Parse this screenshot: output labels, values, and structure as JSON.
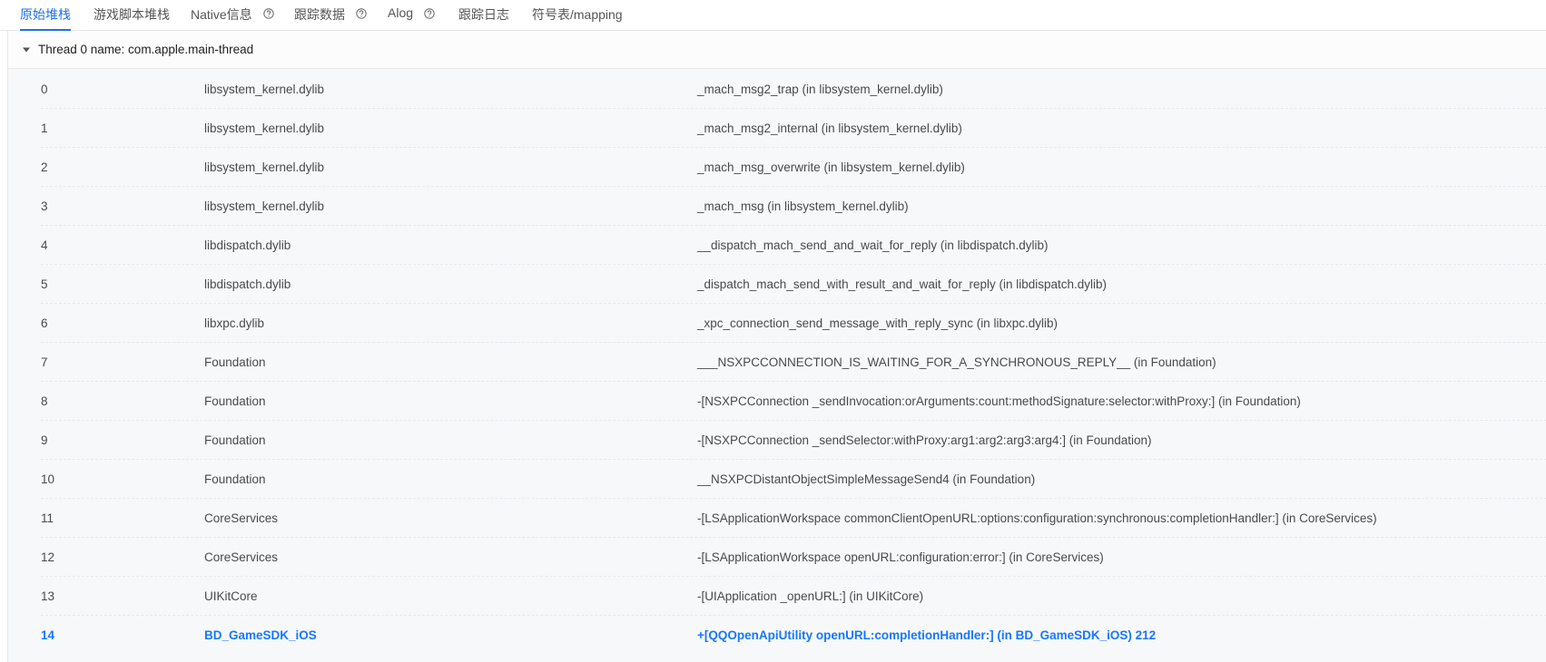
{
  "tabs": [
    {
      "label": "原始堆栈",
      "active": true,
      "has_help": false
    },
    {
      "label": "游戏脚本堆栈",
      "active": false,
      "has_help": false
    },
    {
      "label": "Native信息",
      "active": false,
      "has_help": true
    },
    {
      "label": "跟踪数据",
      "active": false,
      "has_help": true
    },
    {
      "label": "Alog",
      "active": false,
      "has_help": true
    },
    {
      "label": "跟踪日志",
      "active": false,
      "has_help": false
    },
    {
      "label": "符号表/mapping",
      "active": false,
      "has_help": false
    }
  ],
  "thread": {
    "title": "Thread 0 name: com.apple.main-thread",
    "expanded": true
  },
  "frames": [
    {
      "index": "0",
      "library": "libsystem_kernel.dylib",
      "symbol": "_mach_msg2_trap (in libsystem_kernel.dylib)"
    },
    {
      "index": "1",
      "library": "libsystem_kernel.dylib",
      "symbol": "_mach_msg2_internal (in libsystem_kernel.dylib)"
    },
    {
      "index": "2",
      "library": "libsystem_kernel.dylib",
      "symbol": "_mach_msg_overwrite (in libsystem_kernel.dylib)"
    },
    {
      "index": "3",
      "library": "libsystem_kernel.dylib",
      "symbol": "_mach_msg (in libsystem_kernel.dylib)"
    },
    {
      "index": "4",
      "library": "libdispatch.dylib",
      "symbol": "__dispatch_mach_send_and_wait_for_reply (in libdispatch.dylib)"
    },
    {
      "index": "5",
      "library": "libdispatch.dylib",
      "symbol": "_dispatch_mach_send_with_result_and_wait_for_reply (in libdispatch.dylib)"
    },
    {
      "index": "6",
      "library": "libxpc.dylib",
      "symbol": "_xpc_connection_send_message_with_reply_sync (in libxpc.dylib)"
    },
    {
      "index": "7",
      "library": "Foundation",
      "symbol": "___NSXPCCONNECTION_IS_WAITING_FOR_A_SYNCHRONOUS_REPLY__ (in Foundation)"
    },
    {
      "index": "8",
      "library": "Foundation",
      "symbol": "-[NSXPCConnection _sendInvocation:orArguments:count:methodSignature:selector:withProxy:] (in Foundation)"
    },
    {
      "index": "9",
      "library": "Foundation",
      "symbol": "-[NSXPCConnection _sendSelector:withProxy:arg1:arg2:arg3:arg4:] (in Foundation)"
    },
    {
      "index": "10",
      "library": "Foundation",
      "symbol": "__NSXPCDistantObjectSimpleMessageSend4 (in Foundation)"
    },
    {
      "index": "11",
      "library": "CoreServices",
      "symbol": "-[LSApplicationWorkspace commonClientOpenURL:options:configuration:synchronous:completionHandler:] (in CoreServices)"
    },
    {
      "index": "12",
      "library": "CoreServices",
      "symbol": "-[LSApplicationWorkspace openURL:configuration:error:] (in CoreServices)"
    },
    {
      "index": "13",
      "library": "UIKitCore",
      "symbol": "-[UIApplication _openURL:] (in UIKitCore)"
    },
    {
      "index": "14",
      "library": "BD_GameSDK_iOS",
      "symbol": "+[QQOpenApiUtility openURL:completionHandler:] (in BD_GameSDK_iOS) 212",
      "highlight": true
    }
  ],
  "colors": {
    "accent": "#1f6feb",
    "highlight_text": "#1677ff",
    "panel_bg": "#f7f8fa"
  },
  "icons": {
    "help": "question-circle-icon",
    "caret": "caret-down-icon"
  }
}
